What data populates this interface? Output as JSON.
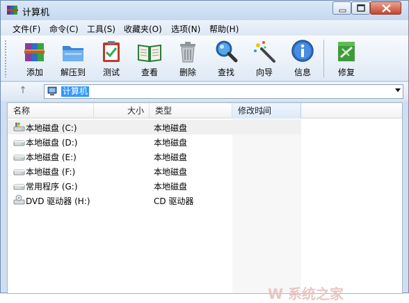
{
  "window": {
    "title": "计算机"
  },
  "menu": [
    "文件(F)",
    "命令(C)",
    "工具(S)",
    "收藏夹(O)",
    "选项(N)",
    "帮助(H)"
  ],
  "toolbar": [
    {
      "label": "添加",
      "icon": "add-archive-icon"
    },
    {
      "label": "解压到",
      "icon": "extract-to-icon"
    },
    {
      "label": "测试",
      "icon": "test-clipboard-icon"
    },
    {
      "label": "查看",
      "icon": "view-book-icon"
    },
    {
      "label": "删除",
      "icon": "delete-trash-icon"
    },
    {
      "label": "查找",
      "icon": "find-magnifier-icon"
    },
    {
      "label": "向导",
      "icon": "wizard-wand-icon"
    },
    {
      "label": "信息",
      "icon": "info-icon"
    },
    {
      "label": "修复",
      "icon": "repair-icon"
    }
  ],
  "address": {
    "path": "计算机"
  },
  "columns": {
    "name": "名称",
    "size": "大小",
    "type": "类型",
    "modified": "修改时间"
  },
  "rows": [
    {
      "name": "本地磁盘 (C:)",
      "type": "本地磁盘",
      "icon": "system-drive-icon"
    },
    {
      "name": "本地磁盘 (D:)",
      "type": "本地磁盘",
      "icon": "hard-drive-icon"
    },
    {
      "name": "本地磁盘 (E:)",
      "type": "本地磁盘",
      "icon": "hard-drive-icon"
    },
    {
      "name": "本地磁盘 (F:)",
      "type": "本地磁盘",
      "icon": "hard-drive-icon"
    },
    {
      "name": "常用程序 (G:)",
      "type": "本地磁盘",
      "icon": "hard-drive-icon"
    },
    {
      "name": "DVD 驱动器 (H:)",
      "type": "CD 驱动器",
      "icon": "dvd-drive-icon"
    }
  ],
  "watermark": "W 系统之家",
  "colors": {
    "accent": "#3399ff",
    "titlebar": "#c4d8ef",
    "close": "#c7452d"
  }
}
